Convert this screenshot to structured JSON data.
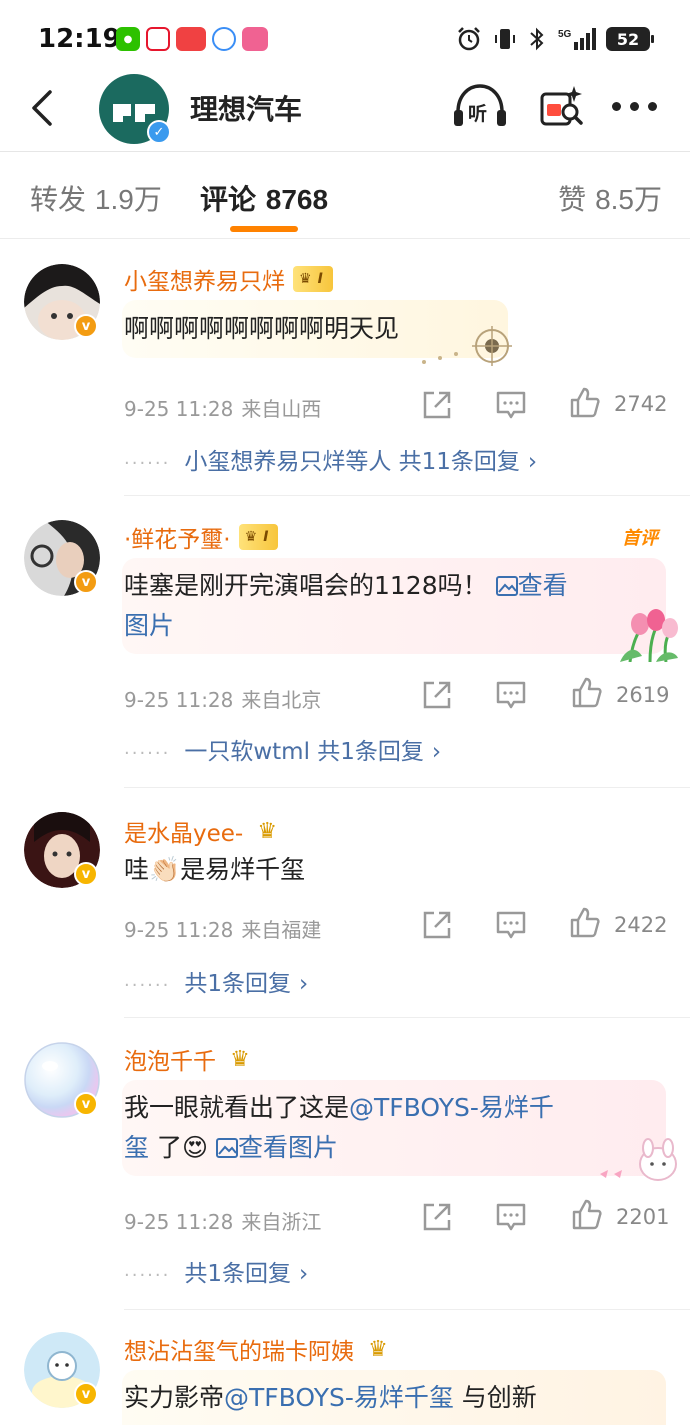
{
  "status": {
    "time": "12:19",
    "battery": "52",
    "network": "5G"
  },
  "header": {
    "title": "理想汽车",
    "listen_label": "听"
  },
  "tabs": {
    "repost_label": "转发",
    "repost_count": "1.9万",
    "comment_label": "评论",
    "comment_count": "8768",
    "like_label": "赞",
    "like_count": "8.5万"
  },
  "comments": [
    {
      "name": "小玺想养易只烊",
      "vip": "I",
      "text": "啊啊啊啊啊啊啊啊明天见",
      "date": "9-25 11:28",
      "location": "来自山西",
      "likes": "2742",
      "replies": "小玺想养易只烊等人  共11条回复"
    },
    {
      "name": "·鲜花予璽·",
      "vip": "I",
      "first_tag": "首评",
      "text_line1": "哇塞是刚开完演唱会的1128吗！",
      "image_link_a": "查看",
      "text_line2": "图片",
      "date": "9-25 11:28",
      "location": "来自北京",
      "likes": "2619",
      "replies": "一只软wtml  共1条回复"
    },
    {
      "name": "是水晶yee-",
      "text": "哇👏🏻是易烊千玺",
      "date": "9-25 11:28",
      "location": "来自福建",
      "likes": "2422",
      "replies": "共1条回复"
    },
    {
      "name": "泡泡千千",
      "text_prefix": "我一眼就看出了这是",
      "mention": "@TFBOYS-易烊千",
      "mention_cont": "玺",
      "text_suffix": " 了😍",
      "image_link": "查看图片",
      "date": "9-25 11:28",
      "location": "来自浙江",
      "likes": "2201",
      "replies": "共1条回复"
    },
    {
      "name": "想沾沾玺气的瑞卡阿姨",
      "text_prefix": "实力影帝",
      "mention": "@TFBOYS-易烊千玺",
      "text_suffix": " 与创新"
    }
  ],
  "colors": {
    "accent": "#ff8200",
    "link": "#3a6fb0",
    "username": "#e86b0e",
    "brand": "#1b6a5f"
  },
  "icons": [
    "back-icon",
    "listen-icon",
    "red-packet-search-icon",
    "more-icon",
    "share-icon",
    "comment-icon",
    "like-icon",
    "image-icon",
    "chevron-right-icon"
  ]
}
